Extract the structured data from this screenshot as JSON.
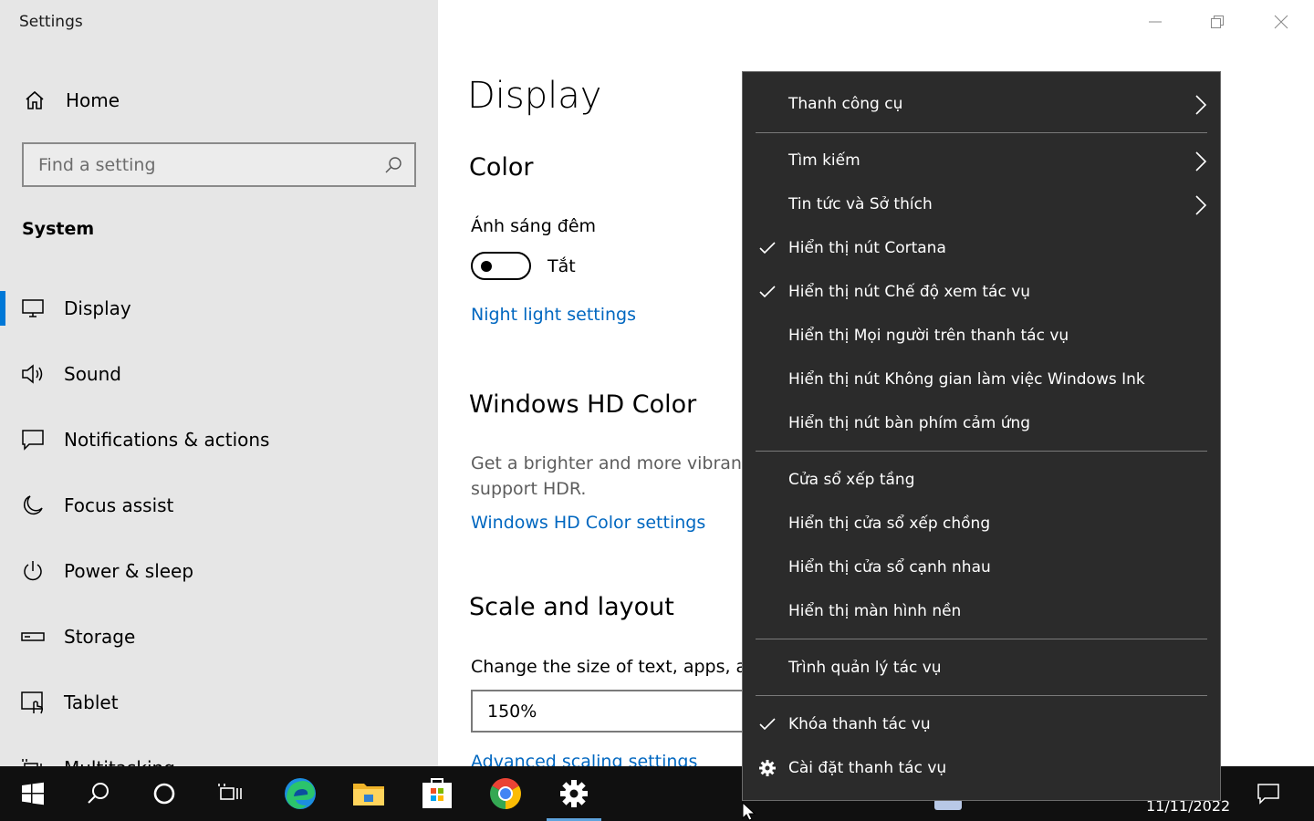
{
  "window": {
    "title": "Settings"
  },
  "sidebar": {
    "home": "Home",
    "search_placeholder": "Find a setting",
    "section": "System",
    "items": [
      {
        "label": "Display",
        "icon": "monitor-icon",
        "active": true
      },
      {
        "label": "Sound",
        "icon": "speaker-icon"
      },
      {
        "label": "Notifications & actions",
        "icon": "notification-icon"
      },
      {
        "label": "Focus assist",
        "icon": "moon-icon"
      },
      {
        "label": "Power & sleep",
        "icon": "power-icon"
      },
      {
        "label": "Storage",
        "icon": "storage-icon"
      },
      {
        "label": "Tablet",
        "icon": "tablet-icon"
      },
      {
        "label": "Multitasking",
        "icon": "multitasking-icon"
      }
    ]
  },
  "main": {
    "title": "Display",
    "color_heading": "Color",
    "night_light_label": "Ánh sáng đêm",
    "night_light_state": "Tắt",
    "night_light_link": "Night light settings",
    "hd_heading": "Windows HD Color",
    "hd_desc_line1": "Get a brighter and more vibrant",
    "hd_desc_line2": "support HDR.",
    "hd_link": "Windows HD Color settings",
    "scale_heading": "Scale and layout",
    "scale_desc": "Change the size of text, apps, an",
    "scale_value": "150%",
    "advanced_link": "Advanced scaling settings"
  },
  "context_menu": {
    "items": [
      {
        "label": "Thanh công cụ",
        "submenu": true
      },
      {
        "label": "Tìm kiếm",
        "submenu": true
      },
      {
        "label": "Tin tức và Sở thích",
        "submenu": true
      },
      {
        "label": "Hiển thị nút Cortana",
        "checked": true
      },
      {
        "label": "Hiển thị nút Chế độ xem tác vụ",
        "checked": true
      },
      {
        "label": "Hiển thị Mọi người trên thanh tác vụ"
      },
      {
        "label": "Hiển thị nút Không gian làm việc Windows Ink"
      },
      {
        "label": "Hiển thị nút bàn phím cảm ứng"
      },
      {
        "label": "Cửa sổ xếp tầng"
      },
      {
        "label": "Hiển thị cửa sổ xếp chồng"
      },
      {
        "label": "Hiển thị cửa sổ cạnh nhau"
      },
      {
        "label": "Hiển thị màn hình nền"
      },
      {
        "label": "Trình quản lý tác vụ"
      },
      {
        "label": "Khóa thanh tác vụ",
        "checked": true
      },
      {
        "label": "Cài đặt thanh tác vụ",
        "icon": "gear-icon"
      }
    ]
  },
  "taskbar": {
    "date": "11/11/2022",
    "apps": [
      "start-icon",
      "search-icon",
      "cortana-icon",
      "task-view-icon",
      "edge-icon",
      "file-explorer-icon",
      "store-icon",
      "chrome-icon",
      "settings-icon"
    ]
  },
  "colors": {
    "accent": "#0078d7",
    "link": "#0067c0",
    "menu_bg": "#2b2b2b",
    "taskbar_bg": "#101010"
  }
}
